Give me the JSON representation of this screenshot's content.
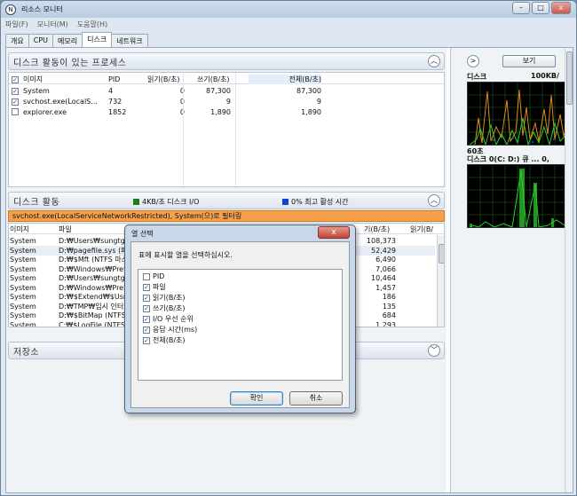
{
  "window": {
    "title": "리소스 모니터",
    "app_icon": "N",
    "min": "–",
    "max": "□",
    "close": "x"
  },
  "menu": [
    "파일(F)",
    "모니터(M)",
    "도움말(H)"
  ],
  "tabs": [
    {
      "label": "개요",
      "active": false
    },
    {
      "label": "CPU",
      "active": false
    },
    {
      "label": "메모리",
      "active": false
    },
    {
      "label": "디스크",
      "active": true
    },
    {
      "label": "네트워크",
      "active": false
    }
  ],
  "processes": {
    "title": "디스크 활동이 있는 프로세스",
    "headers": [
      "이미지",
      "PID",
      "읽기(B/초)",
      "쓰기(B/초)",
      "전체(B/초)"
    ],
    "rows": [
      {
        "checked": true,
        "image": "System",
        "pid": "4",
        "read": "0",
        "write": "87,300",
        "total": "87,300"
      },
      {
        "checked": true,
        "image": "svchost.exe(LocalS...",
        "pid": "732",
        "read": "0",
        "write": "9",
        "total": "9"
      },
      {
        "checked": false,
        "image": "explorer.exe",
        "pid": "1852",
        "read": "0",
        "write": "1,890",
        "total": "1,890"
      }
    ]
  },
  "disk_activity": {
    "title": "디스크 활동",
    "legend_io": "4KB/초 디스크 I/O",
    "legend_active": "0% 최고 활성 시간",
    "io_color": "#1f7a1f",
    "active_color": "#1a3fd0",
    "filter": "svchost.exe(LocalServiceNetworkRestricted), System(으)로 필터링",
    "headers": [
      "이미지",
      "파일",
      "기(B/초)",
      "읽기(B/"
    ],
    "rows": [
      {
        "image": "System",
        "file": "D:₩Users₩sungtg₩",
        "total": "108,373"
      },
      {
        "image": "System",
        "file": "D:₩pagefile.sys (페",
        "total": "52,429"
      },
      {
        "image": "System",
        "file": "D:₩$Mft (NTFS 마스",
        "total": "6,490"
      },
      {
        "image": "System",
        "file": "D:₩Windows₩Prefe",
        "total": "7,066"
      },
      {
        "image": "System",
        "file": "D:₩Users₩sungtg₩",
        "total": "10,464"
      },
      {
        "image": "System",
        "file": "D:₩Windows₩Prefe",
        "total": "1,457"
      },
      {
        "image": "System",
        "file": "D:₩$Extend₩$UsnJ",
        "total": "186"
      },
      {
        "image": "System",
        "file": "D:₩TMP₩임시 인터넷",
        "total": "135"
      },
      {
        "image": "System",
        "file": "D:₩$BitMap (NTFS /",
        "total": "684"
      },
      {
        "image": "System",
        "file": "C:₩$LogFile (NTFS",
        "total": "1,293"
      }
    ]
  },
  "storage": {
    "title": "저장소"
  },
  "right": {
    "expand_icon": ">",
    "view_button": "보기",
    "graph1_label": "디스크",
    "graph1_scale": "100KB/",
    "graph1_time": "60초",
    "graph2_label": "디스크 0(C: D:) 큐 ... 0,"
  },
  "dialog": {
    "title": "열 선택",
    "prompt": "표에 표시할 열을 선택하십시오.",
    "columns": [
      {
        "label": "PID",
        "checked": false
      },
      {
        "label": "파일",
        "checked": true
      },
      {
        "label": "읽기(B/초)",
        "checked": true
      },
      {
        "label": "쓰기(B/초)",
        "checked": true
      },
      {
        "label": "I/O 우선 순위",
        "checked": true
      },
      {
        "label": "응답 시간(ms)",
        "checked": true
      },
      {
        "label": "전체(B/초)",
        "checked": true
      }
    ],
    "ok": "확인",
    "cancel": "취소",
    "close": "x"
  }
}
